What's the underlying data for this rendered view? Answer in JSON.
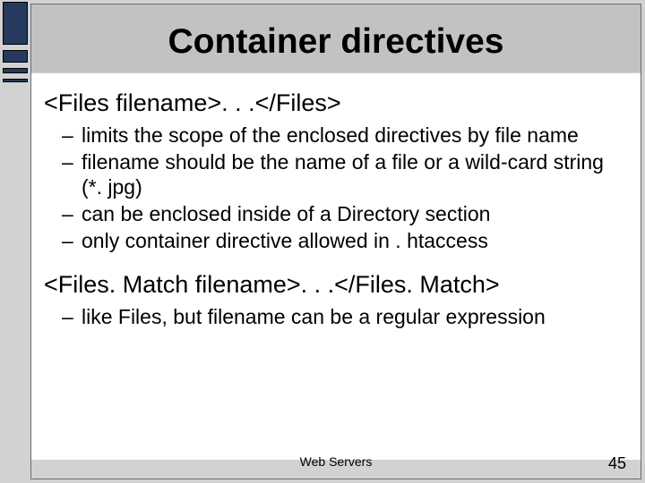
{
  "title": "Container directives",
  "section1": {
    "heading": "<Files filename>. . .</Files>",
    "bullets": [
      "limits the scope of the enclosed directives by file name",
      "filename should be the name of a file or a wild-card string (*. jpg)",
      "can be enclosed inside of a Directory section",
      "only container directive allowed in . htaccess"
    ]
  },
  "section2": {
    "heading": "<Files. Match filename>. . .</Files. Match>",
    "bullets": [
      "like Files, but filename can be a regular expression"
    ]
  },
  "footer_center": "Web Servers",
  "footer_page": "45"
}
